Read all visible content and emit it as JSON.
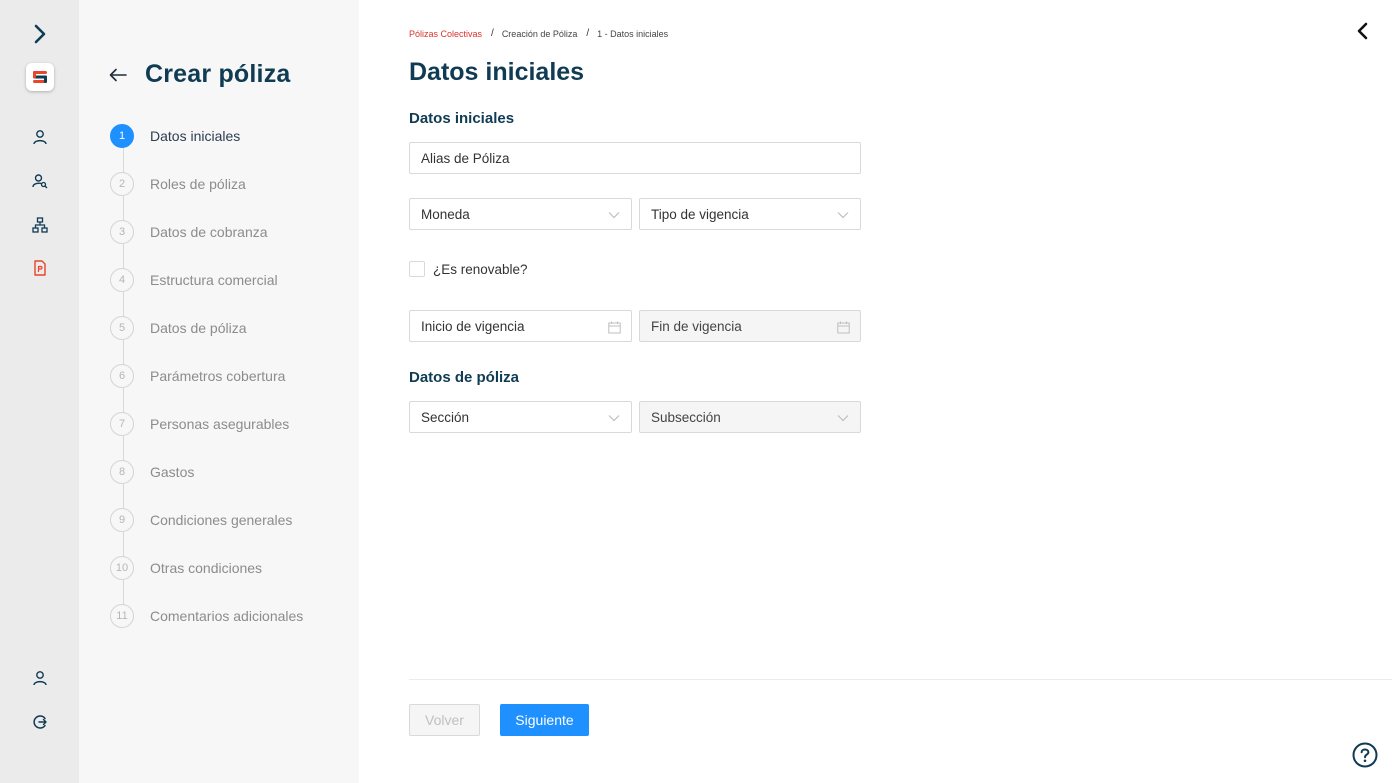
{
  "rail": {
    "logo_letter": "S",
    "colors": {
      "icon": "#0f3b53",
      "active_icon": "#e8452c",
      "logo_accent": "#e8452c"
    },
    "icons": [
      "chevron-right-icon",
      "user-icon",
      "users-search-icon",
      "org-chart-icon",
      "policy-document-icon",
      "account-icon",
      "logout-icon"
    ]
  },
  "steps_panel": {
    "title": "Crear póliza",
    "steps": [
      {
        "number": "1",
        "label": "Datos iniciales",
        "active": true
      },
      {
        "number": "2",
        "label": "Roles de póliza"
      },
      {
        "number": "3",
        "label": "Datos de cobranza"
      },
      {
        "number": "4",
        "label": "Estructura comercial"
      },
      {
        "number": "5",
        "label": "Datos de póliza"
      },
      {
        "number": "6",
        "label": "Parámetros cobertura"
      },
      {
        "number": "7",
        "label": "Personas asegurables"
      },
      {
        "number": "8",
        "label": "Gastos"
      },
      {
        "number": "9",
        "label": "Condiciones generales"
      },
      {
        "number": "10",
        "label": "Otras condiciones"
      },
      {
        "number": "11",
        "label": "Comentarios adicionales"
      }
    ]
  },
  "breadcrumb": [
    "Pólizas Colectivas",
    "Creación de Póliza",
    "1 - Datos iniciales"
  ],
  "main": {
    "title": "Datos iniciales",
    "section_initial": "Datos iniciales",
    "section_policy": "Datos de póliza",
    "fields": {
      "alias": "Alias de Póliza",
      "currency": "Moneda",
      "validity_type": "Tipo de vigencia",
      "renewable": "¿Es renovable?",
      "start_date": "Inicio de vigencia",
      "end_date": "Fin de vigencia",
      "section": "Sección",
      "subsection": "Subsección"
    }
  },
  "footer": {
    "back_label": "Volver",
    "next_label": "Siguiente"
  },
  "colors": {
    "primary": "#1e90ff",
    "heading": "#0f3b53",
    "breadcrumb_link": "#d9332e"
  }
}
